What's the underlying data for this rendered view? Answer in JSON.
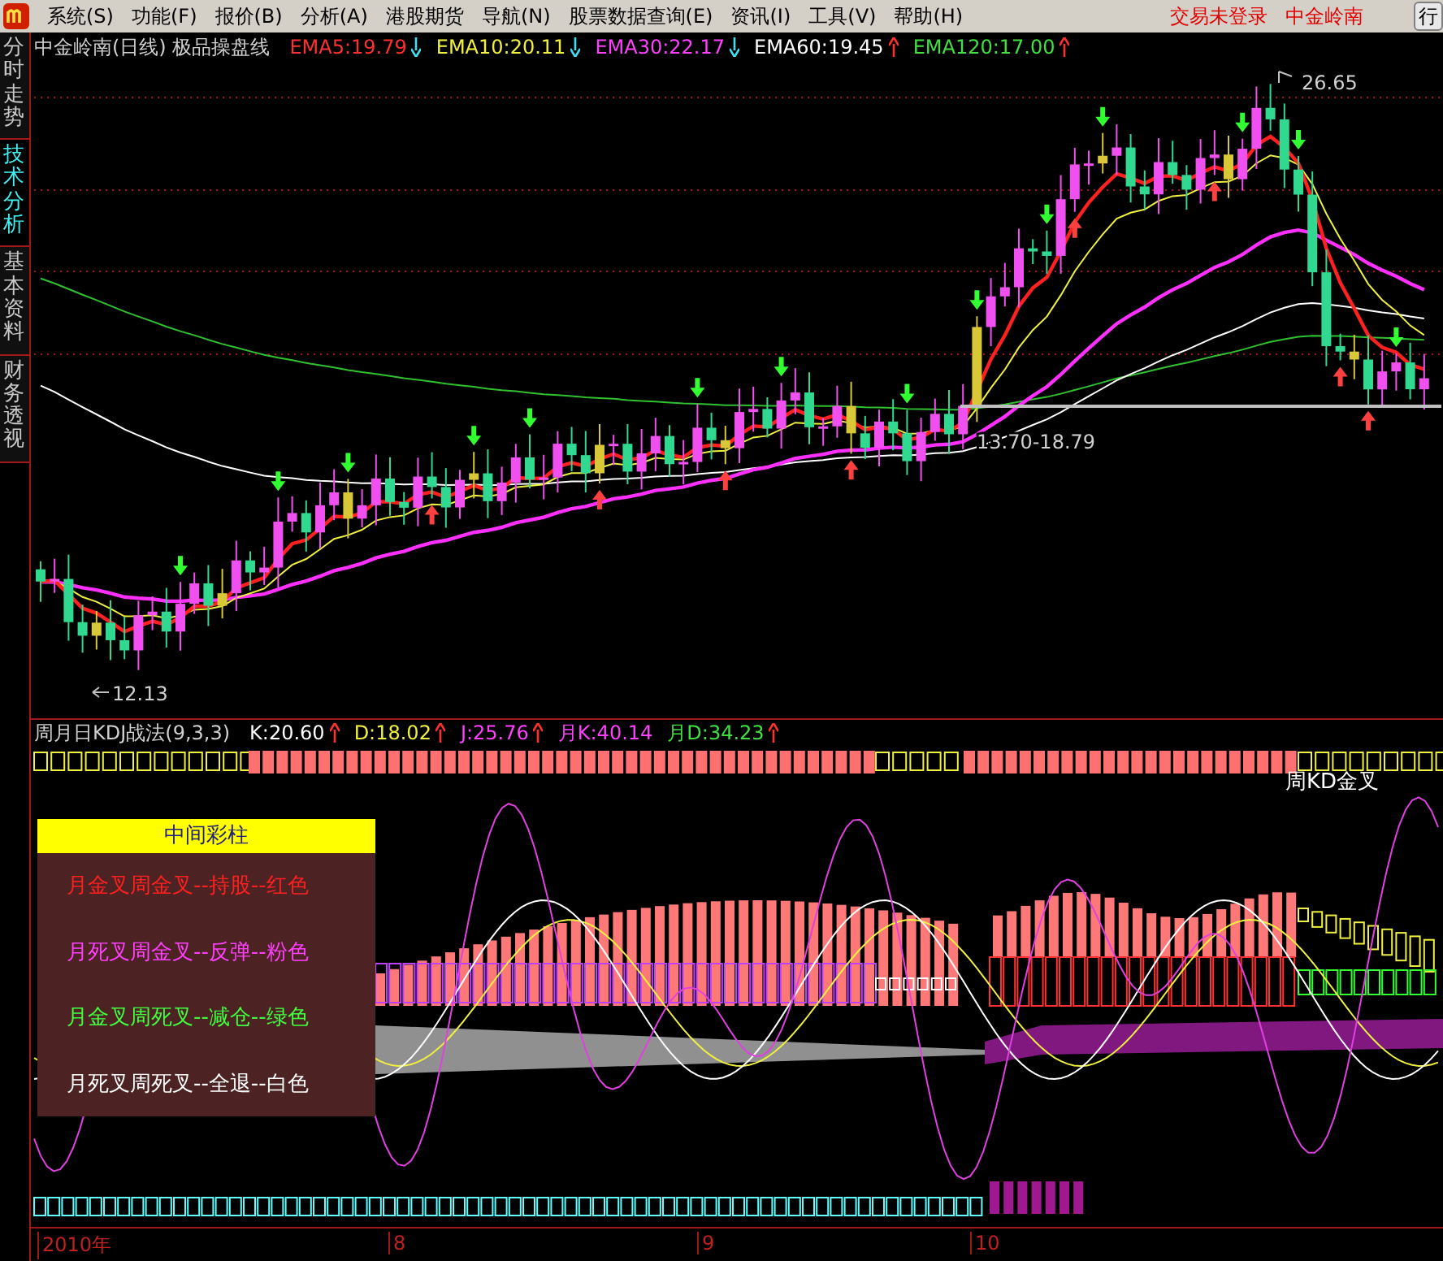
{
  "menu_bar": {
    "items": [
      {
        "label": "系统(S)"
      },
      {
        "label": "功能(F)"
      },
      {
        "label": "报价(B)"
      },
      {
        "label": "分析(A)"
      },
      {
        "label": "港股期货"
      },
      {
        "label": "导航(N)"
      },
      {
        "label": "股票数据查询(E)"
      },
      {
        "label": "资讯(I)"
      },
      {
        "label": "工具(V)"
      },
      {
        "label": "帮助(H)"
      }
    ],
    "login_status": "交易未登录",
    "stock_name": "中金岭南",
    "edge_button": "行"
  },
  "side_tabs": [
    {
      "label": "分时走势",
      "selected": false
    },
    {
      "label": "技术分析",
      "selected": true
    },
    {
      "label": "基本资料",
      "selected": false
    },
    {
      "label": "财务透视",
      "selected": false
    }
  ],
  "price_chart": {
    "title": "中金岭南(日线) 极品操盘线",
    "indicators": [
      {
        "label": "EMA5:19.79",
        "color": "#ff3030",
        "arrow": true,
        "rising": false
      },
      {
        "label": "EMA10:20.11",
        "color": "#f0f040",
        "arrow": true,
        "rising": false
      },
      {
        "label": "EMA30:22.17",
        "color": "#ff40ff",
        "arrow": true,
        "rising": false
      },
      {
        "label": "EMA60:19.45",
        "color": "#ffffff",
        "arrow": true,
        "rising": true
      },
      {
        "label": "EMA120:17.00",
        "color": "#40e040",
        "arrow": true,
        "rising": true
      }
    ],
    "high_label": "26.65",
    "low_label": "12.13",
    "range_label": "13.70-18.79"
  },
  "kdj_pane": {
    "title": "周月日KDJ战法(9,3,3)",
    "readings": [
      {
        "label": "K:20.60",
        "color": "#ffffff",
        "arrow": true
      },
      {
        "label": "D:18.02",
        "color": "#f0f040",
        "arrow": true
      },
      {
        "label": "J:25.76",
        "color": "#ff40ff",
        "arrow": true
      },
      {
        "label": "月K:40.14",
        "color": "#ff40ff",
        "arrow": false
      },
      {
        "label": "月D:34.23",
        "color": "#40e040",
        "arrow": true
      }
    ],
    "signal_label": "周KD金叉",
    "legend": {
      "title": "中间彩柱",
      "lines": [
        {
          "text": "月金叉周金叉--持股--红色",
          "color": "#ff2020"
        },
        {
          "text": "月死叉周金叉--反弹--粉色",
          "color": "#ff40ff"
        },
        {
          "text": "月金叉周死叉--减仓--绿色",
          "color": "#40ff40"
        },
        {
          "text": "月死叉周死叉--全退--白色",
          "color": "#ffffff"
        }
      ]
    }
  },
  "time_axis": {
    "labels": [
      "2010年",
      "8",
      "9",
      "10"
    ]
  }
}
